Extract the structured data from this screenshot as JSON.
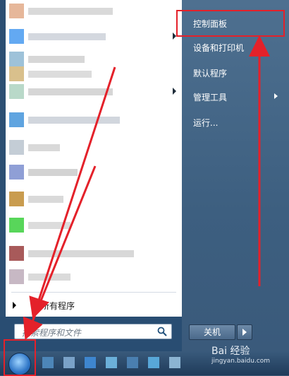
{
  "right_menu": {
    "items": [
      {
        "label": "控制面板",
        "has_submenu": false
      },
      {
        "label": "设备和打印机",
        "has_submenu": false
      },
      {
        "label": "默认程序",
        "has_submenu": false
      },
      {
        "label": "管理工具",
        "has_submenu": true
      },
      {
        "label": "运行...",
        "has_submenu": false
      }
    ]
  },
  "left_menu": {
    "all_programs_label": "所有程序",
    "search_placeholder": "搜索程序和文件"
  },
  "shutdown": {
    "label": "关机"
  },
  "watermark": {
    "brand": "Bai 经验",
    "url": "jingyan.baidu.com"
  },
  "colors": {
    "annotation": "#e4212a",
    "menu_right_bg": "#4a6b8c"
  },
  "icons": {
    "start": "windows-start-orb",
    "search": "search-icon"
  }
}
